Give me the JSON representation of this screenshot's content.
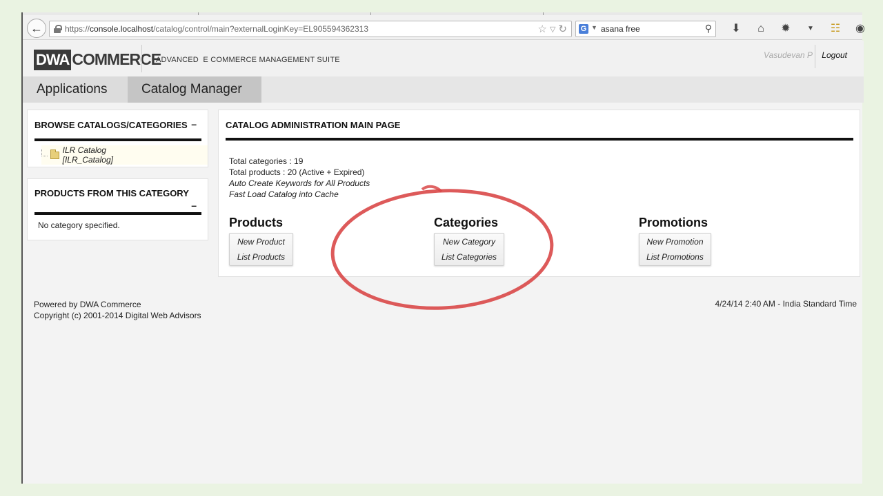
{
  "browser": {
    "url_prefix": "https://",
    "url_host": "console.localhost",
    "url_path": "/catalog/control/main?externalLoginKey=EL905594362313",
    "search_engine": "G",
    "search_text": "asana free"
  },
  "header": {
    "logo_box": "DWA",
    "logo_rest": "COMMERCE",
    "suite_title": "ADVANCED  E COMMERCE MANAGEMENT SUITE",
    "user_name": "Vasudevan P",
    "logout_label": "Logout"
  },
  "nav": {
    "tabs": [
      {
        "label": "Applications"
      },
      {
        "label": "Catalog Manager"
      }
    ]
  },
  "sidebar": {
    "browse": {
      "title": "BROWSE CATALOGS/CATEGORIES",
      "collapse": "–",
      "items": [
        {
          "label": "ILR Catalog [ILR_Catalog]"
        }
      ]
    },
    "products": {
      "title": "PRODUCTS FROM THIS CATEGORY",
      "collapse": "–",
      "empty_text": "No category specified."
    }
  },
  "main": {
    "title": "CATALOG ADMINISTRATION MAIN PAGE",
    "total_categories": "Total categories : 19",
    "total_products": "Total products : 20 (Active + Expired)",
    "auto_keywords": "Auto Create Keywords for All Products",
    "fast_load": "Fast Load Catalog into Cache",
    "sections": [
      {
        "title": "Products",
        "links": [
          "New Product",
          "List Products"
        ]
      },
      {
        "title": "Categories",
        "links": [
          "New Category",
          "List Categories"
        ]
      },
      {
        "title": "Promotions",
        "links": [
          "New Promotion",
          "List Promotions"
        ]
      }
    ]
  },
  "footer": {
    "powered_by": "Powered by DWA Commerce",
    "copyright": "Copyright (c) 2001-2014 Digital Web Advisors",
    "timestamp": "4/24/14 2:40 AM - India Standard Time"
  },
  "colors": {
    "annotation_circle": "#d94848",
    "tab_active": "#c5c5c5"
  }
}
